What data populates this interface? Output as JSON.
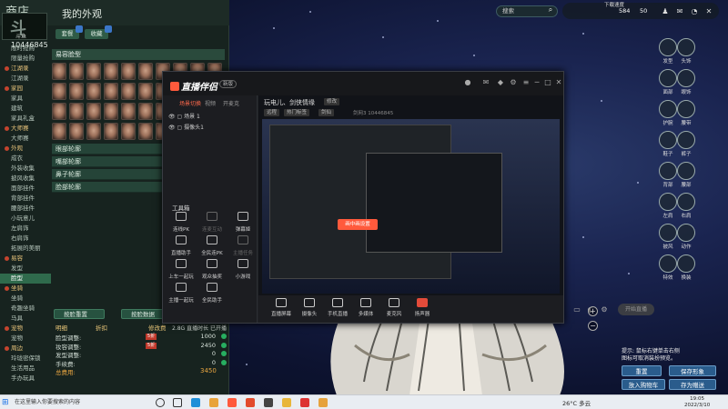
{
  "store": {
    "shop_title": "商店",
    "my_look": "我的外观",
    "logo_name": "斗鱼",
    "room_id": "10446845",
    "menu": [
      {
        "label": "限时抢购",
        "type": "item"
      },
      {
        "label": "限量抢购",
        "type": "item"
      },
      {
        "label": "江湖录",
        "type": "cat"
      },
      {
        "label": "江湖录",
        "type": "item"
      },
      {
        "label": "家园",
        "type": "cat"
      },
      {
        "label": "家具",
        "type": "item"
      },
      {
        "label": "建筑",
        "type": "item"
      },
      {
        "label": "家具礼盒",
        "type": "item"
      },
      {
        "label": "大师赛",
        "type": "cat"
      },
      {
        "label": "大师赛",
        "type": "item"
      },
      {
        "label": "外观",
        "type": "cat"
      },
      {
        "label": "成衣",
        "type": "item"
      },
      {
        "label": "外装收集",
        "type": "item"
      },
      {
        "label": "披风收集",
        "type": "item"
      },
      {
        "label": "面部挂件",
        "type": "item"
      },
      {
        "label": "背部挂件",
        "type": "item"
      },
      {
        "label": "腰部挂件",
        "type": "item"
      },
      {
        "label": "小玩意儿",
        "type": "item"
      },
      {
        "label": "左肩饰",
        "type": "item"
      },
      {
        "label": "右肩饰",
        "type": "item"
      },
      {
        "label": "拓展的美丽",
        "type": "item"
      },
      {
        "label": "易容",
        "type": "cat"
      },
      {
        "label": "发型",
        "type": "item"
      },
      {
        "label": "脸型",
        "type": "item",
        "selected": true
      },
      {
        "label": "坐骑",
        "type": "cat"
      },
      {
        "label": "坐骑",
        "type": "item"
      },
      {
        "label": "奇趣坐骑",
        "type": "item"
      },
      {
        "label": "马具",
        "type": "item"
      },
      {
        "label": "宠物",
        "type": "cat"
      },
      {
        "label": "宠物",
        "type": "item"
      },
      {
        "label": "周边",
        "type": "cat"
      },
      {
        "label": "玲珑密保锁",
        "type": "item"
      },
      {
        "label": "生活用品",
        "type": "item"
      },
      {
        "label": "手办玩具",
        "type": "item"
      }
    ],
    "tabs": [
      "套餐",
      "收藏"
    ],
    "section_face": "易容脸型",
    "properties": [
      "眼部轮廓",
      "嘴部轮廓",
      "鼻子轮廓",
      "脸部轮廓"
    ],
    "btn_reset": "按脸重置",
    "btn_load": "按脸数据",
    "summary": {
      "col_name": "明细",
      "col_discount": "折扣",
      "col_price": "修改费",
      "rows": [
        {
          "label": "脸型调整:",
          "badge": "5折",
          "value": "1000"
        },
        {
          "label": "妆容调整:",
          "badge": "5折",
          "value": "2450"
        },
        {
          "label": "发型调整:",
          "badge": "",
          "value": "0"
        },
        {
          "label": "手续费:",
          "badge": "",
          "value": "0"
        }
      ],
      "total_label": "总费用:",
      "total_value": "3450"
    },
    "net_info": "2.8G 直播时长 已开播"
  },
  "stream_app": {
    "logo": "直播伴侣",
    "version": "新版",
    "tabs": [
      "场景切换",
      "视频",
      "开麦克"
    ],
    "scenes": [
      "场景 1",
      "摄像头1"
    ],
    "tools_title": "工具箱",
    "tools": [
      {
        "label": "连线PK",
        "off": false
      },
      {
        "label": "连麦互动",
        "off": true
      },
      {
        "label": "弹幕姬",
        "off": false
      },
      {
        "label": "直播助手",
        "off": false
      },
      {
        "label": "全民连PK",
        "off": false
      },
      {
        "label": "主播任务",
        "off": true
      },
      {
        "label": "上车一起玩",
        "off": false
      },
      {
        "label": "观众抽奖",
        "off": false
      },
      {
        "label": "小游戏",
        "off": false
      },
      {
        "label": "主播一起玩",
        "off": false
      },
      {
        "label": "全民助手",
        "off": false
      }
    ],
    "preview_title": "玩电儿、剑侠情缘",
    "preview_tag": "修改",
    "tags": [
      "远程",
      "热门标签",
      "剑仙"
    ],
    "preview_id": "剑网3 10446845",
    "orange_btn": "画中画设置",
    "bottom_tools": [
      {
        "label": "直播屏幕",
        "red": false
      },
      {
        "label": "摄像头",
        "red": false
      },
      {
        "label": "手机直播",
        "red": false
      },
      {
        "label": "多媒体",
        "red": false
      },
      {
        "label": "麦克风",
        "red": false
      },
      {
        "label": "扬声器",
        "red": true
      }
    ],
    "start_live": "开始直播",
    "window_controls": [
      "─",
      "□",
      "✕"
    ]
  },
  "hud": {
    "search_placeholder": "搜索",
    "download_speed": "下载速度",
    "coin1": "584",
    "coin2": "50",
    "right_buttons": [
      {
        "label": "发型",
        "icon": "hair-icon"
      },
      {
        "label": "头饰",
        "icon": "head-icon"
      },
      {
        "label": "面部",
        "icon": "face-icon"
      },
      {
        "label": "眼饰",
        "icon": "eye-icon"
      },
      {
        "label": "护腕",
        "icon": "wrist-icon"
      },
      {
        "label": "腰带",
        "icon": "belt-icon"
      },
      {
        "label": "鞋子",
        "icon": "shoes-icon"
      },
      {
        "label": "裤子",
        "icon": "pants-icon"
      },
      {
        "label": "背部",
        "icon": "back-icon"
      },
      {
        "label": "腰部",
        "icon": "waist-icon"
      },
      {
        "label": "左肩",
        "icon": "shoulder-l-icon"
      },
      {
        "label": "右肩",
        "icon": "shoulder-r-icon"
      },
      {
        "label": "披风",
        "icon": "cape-icon"
      },
      {
        "label": "动作",
        "icon": "pose-icon"
      },
      {
        "label": "特效",
        "icon": "fx-icon"
      },
      {
        "label": "换装",
        "icon": "outfit-icon"
      }
    ],
    "hint_line1": "提示: 鼠标右键单击右侧",
    "hint_line2": "图标可取消装扮预览。",
    "btn_reset": "重置",
    "btn_save": "保存形象",
    "btn_cart": "放入购物车",
    "btn_gift": "存为赠送"
  },
  "taskbar": {
    "search": "在这里输入你要搜索的内容",
    "temp": "26°C 多云",
    "time": "19:05",
    "date": "2022/3/10"
  }
}
